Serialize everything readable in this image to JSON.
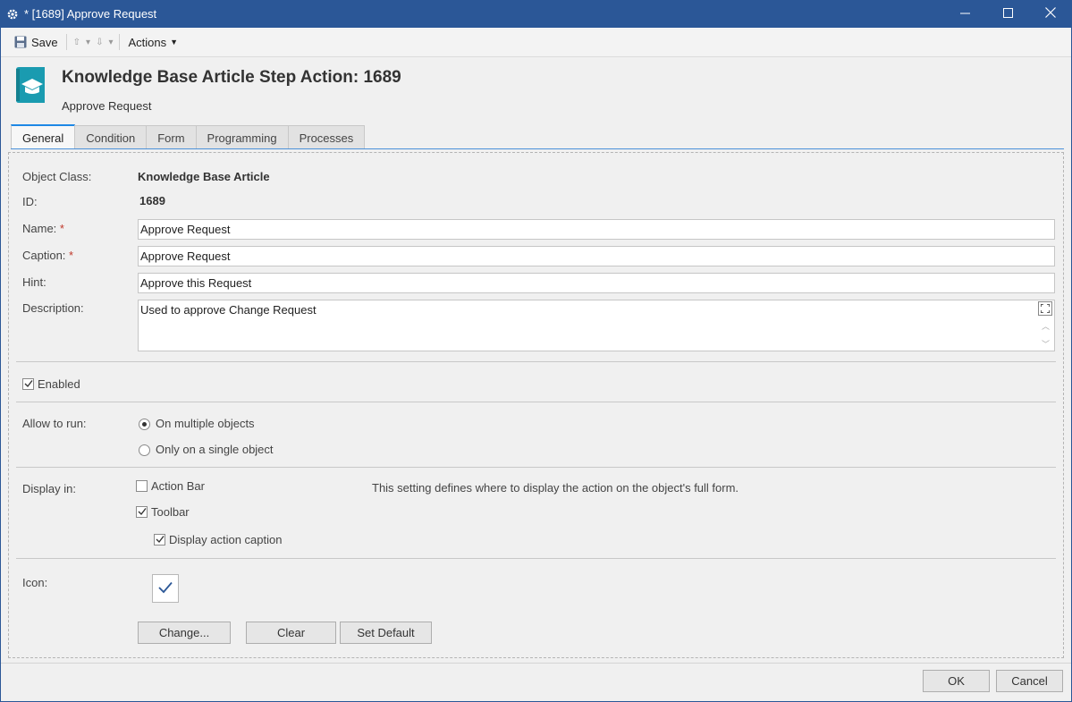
{
  "window": {
    "title": "* [1689] Approve Request",
    "minimize_icon": "minimize-icon",
    "maximize_icon": "maximize-icon",
    "close_icon": "close-icon"
  },
  "toolbar": {
    "save_label": "Save",
    "actions_label": "Actions"
  },
  "header": {
    "title": "Knowledge Base Article Step Action: 1689",
    "subtitle": "Approve Request",
    "icon": "knowledge-base-icon",
    "icon_color": "#1a9bb0"
  },
  "tabs": [
    {
      "label": "General",
      "active": true
    },
    {
      "label": "Condition",
      "active": false
    },
    {
      "label": "Form",
      "active": false
    },
    {
      "label": "Programming",
      "active": false
    },
    {
      "label": "Processes",
      "active": false
    }
  ],
  "form": {
    "object_class_label": "Object Class:",
    "object_class_value": "Knowledge Base Article",
    "id_label": "ID:",
    "id_value": "1689",
    "name_label": "Name:",
    "name_value": "Approve Request",
    "caption_label": "Caption:",
    "caption_value": "Approve Request",
    "hint_label": "Hint:",
    "hint_value": "Approve this Request",
    "description_label": "Description:",
    "description_value": "Used to approve Change Request",
    "required_marker": "*",
    "enabled_label": "Enabled",
    "enabled_checked": true,
    "allow_to_run_label": "Allow to run:",
    "run_multiple_label": "On multiple objects",
    "run_single_label": "Only on a single object",
    "run_selected": "multiple",
    "display_in_label": "Display in:",
    "action_bar_label": "Action Bar",
    "action_bar_checked": false,
    "toolbar_label": "Toolbar",
    "toolbar_checked": true,
    "display_caption_label": "Display action caption",
    "display_caption_checked": true,
    "display_hint": "This setting defines where to display the action on the object's full form.",
    "icon_label": "Icon:",
    "icon_value": "checkmark-icon",
    "change_label": "Change...",
    "clear_label": "Clear",
    "set_default_label": "Set Default"
  },
  "footer": {
    "ok_label": "OK",
    "cancel_label": "Cancel"
  },
  "colors": {
    "titlebar": "#2b5797",
    "tab_accent": "#1e88e5",
    "checkmark": "#2b5797"
  }
}
